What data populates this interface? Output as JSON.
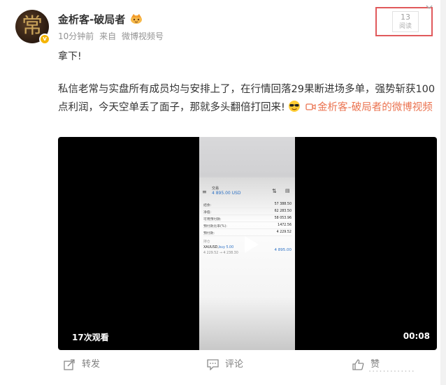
{
  "author": {
    "name": "金析客-破局者",
    "avatar_glyph": "常",
    "verified_glyph": "v",
    "badge_icon": "crown-icon"
  },
  "meta": {
    "time": "10分钟前",
    "source_prefix": "来自",
    "source": "微博视频号"
  },
  "read_counter": {
    "count": "13",
    "label": "阅读"
  },
  "post": {
    "line1": "拿下!",
    "body": "私信老常与实盘所有成员均与安排上了，在行情回落29果断进场多单，强势斩获100点利润，今天空单丢了面子，那就多头翻倍打回来!",
    "emoji_icon": "cool-sunglasses-emoji-icon",
    "video_link": "金析客-破局者的微博视频"
  },
  "video": {
    "views": "17次观看",
    "duration": "00:08",
    "phone": {
      "account_label": "交易",
      "balance": "4 895.00 USD",
      "rows": [
        {
          "k": "结余:",
          "v": "57 388.50"
        },
        {
          "k": "净值:",
          "v": "62 283.50"
        },
        {
          "k": "可用预付款:",
          "v": "58 053.96"
        },
        {
          "k": "预付款比率(%):",
          "v": "1472.56"
        },
        {
          "k": "预付款:",
          "v": "4 229.52"
        }
      ],
      "section": "持仓",
      "position": {
        "symbol": "XAUUSD,",
        "side": "buy 5.00",
        "prices": "4 229.52 → 4 238.30",
        "pnl": "4 895.00"
      }
    }
  },
  "actions": {
    "repost": "转发",
    "comment": "评论",
    "like": "赞"
  },
  "colors": {
    "link": "#eb7350",
    "highlight_box": "#e0595b",
    "muted": "#939393"
  }
}
